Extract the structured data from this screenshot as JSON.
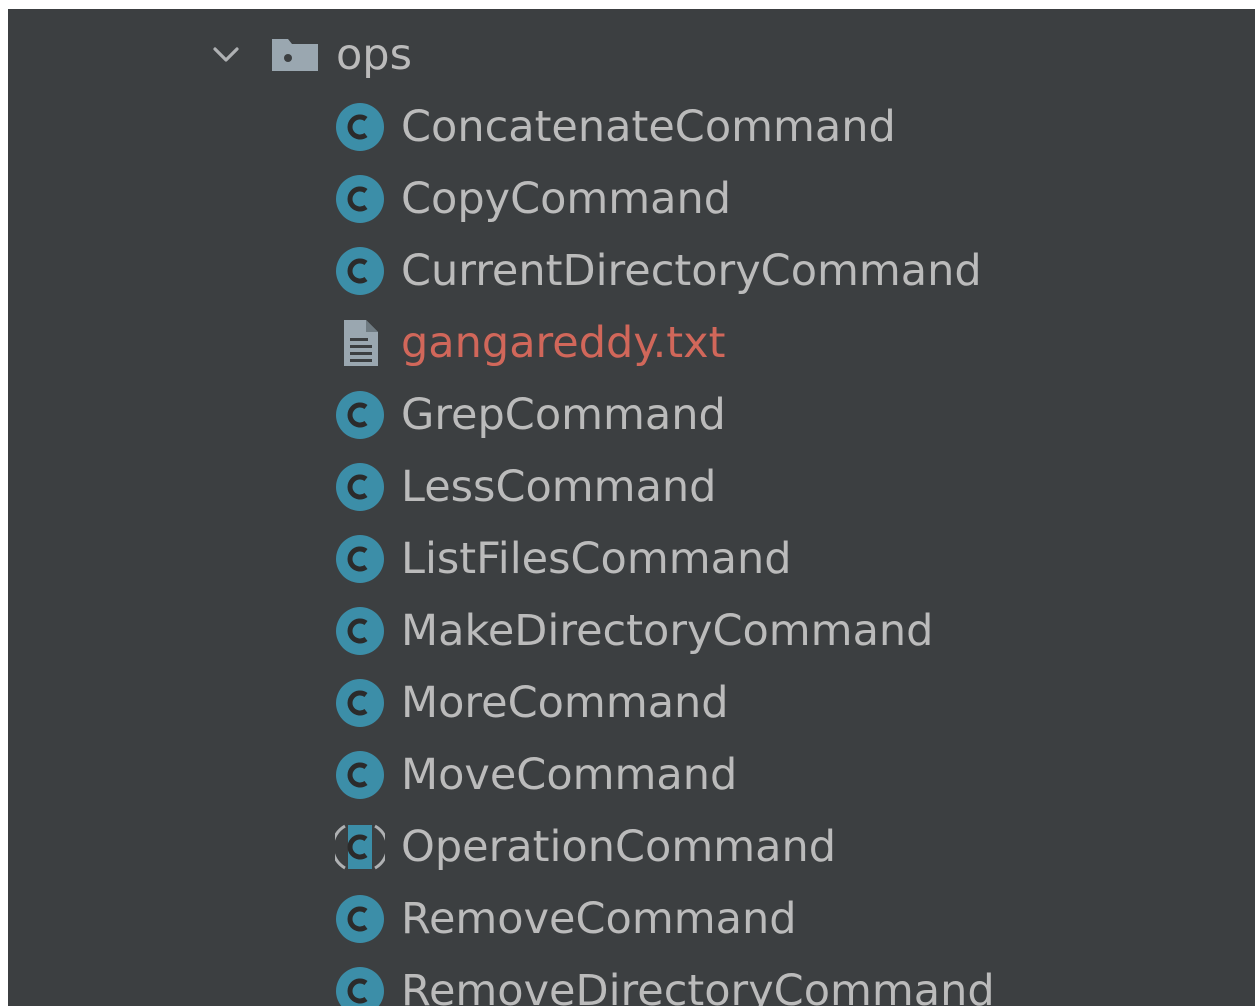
{
  "colors": {
    "panel_bg": "#3c3f41",
    "text_default": "#bbbbbb",
    "text_untracked": "#d1675a",
    "class_icon": "#3c8ea8",
    "folder_icon": "#9aa7b0",
    "file_icon": "#9aa7b0"
  },
  "project_tree": {
    "folder": {
      "label": "ops",
      "icon": "folder-icon",
      "expanded": true
    },
    "items": [
      {
        "label": "ConcatenateCommand",
        "icon": "class-icon",
        "status": "default"
      },
      {
        "label": "CopyCommand",
        "icon": "class-icon",
        "status": "default"
      },
      {
        "label": "CurrentDirectoryCommand",
        "icon": "class-icon",
        "status": "default"
      },
      {
        "label": "gangareddy.txt",
        "icon": "text-file-icon",
        "status": "untracked"
      },
      {
        "label": "GrepCommand",
        "icon": "class-icon",
        "status": "default"
      },
      {
        "label": "LessCommand",
        "icon": "class-icon",
        "status": "default"
      },
      {
        "label": "ListFilesCommand",
        "icon": "class-icon",
        "status": "default"
      },
      {
        "label": "MakeDirectoryCommand",
        "icon": "class-icon",
        "status": "default"
      },
      {
        "label": "MoreCommand",
        "icon": "class-icon",
        "status": "default"
      },
      {
        "label": "MoveCommand",
        "icon": "class-icon",
        "status": "default"
      },
      {
        "label": "OperationCommand",
        "icon": "abstract-class-icon",
        "status": "default"
      },
      {
        "label": "RemoveCommand",
        "icon": "class-icon",
        "status": "default"
      },
      {
        "label": "RemoveDirectoryCommand",
        "icon": "class-icon",
        "status": "default"
      }
    ]
  }
}
